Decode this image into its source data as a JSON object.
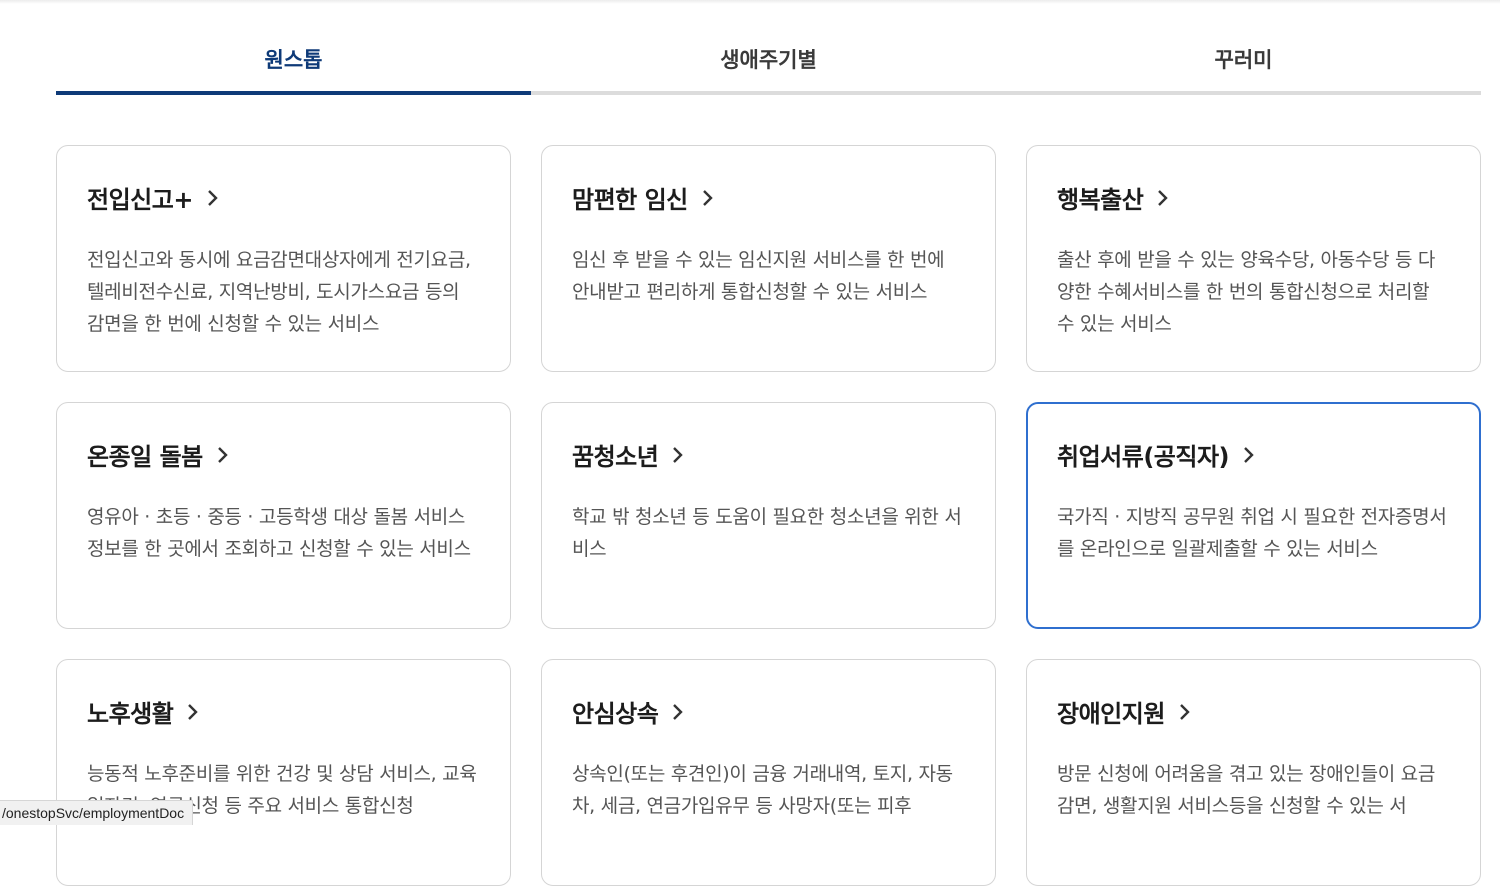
{
  "tabs": [
    {
      "label": "원스톱",
      "active": true
    },
    {
      "label": "생애주기별",
      "active": false
    },
    {
      "label": "꾸러미",
      "active": false
    }
  ],
  "cards": [
    {
      "title": "전입신고+",
      "desc": "전입신고와 동시에 요금감면대상자에게 전기요금, 텔레비전수신료, 지역난방비, 도시가스요금 등의 감면을 한 번에 신청할 수 있는 서비스"
    },
    {
      "title": "맘편한 임신",
      "desc": "임신 후 받을 수 있는 임신지원 서비스를 한 번에 안내받고 편리하게 통합신청할 수 있는 서비스"
    },
    {
      "title": "행복출산",
      "desc": "출산 후에 받을 수 있는 양육수당, 아동수당 등 다양한 수혜서비스를 한 번의 통합신청으로 처리할 수 있는 서비스"
    },
    {
      "title": "온종일 돌봄",
      "desc": "영유아 · 초등 · 중등 · 고등학생 대상 돌봄 서비스 정보를 한 곳에서 조회하고 신청할 수 있는 서비스"
    },
    {
      "title": "꿈청소년",
      "desc": "학교 밖 청소년 등 도움이 필요한 청소년을 위한 서비스"
    },
    {
      "title": "취업서류(공직자)",
      "desc": "국가직 · 지방직 공무원 취업 시 필요한 전자증명서를 온라인으로 일괄제출할 수 있는 서비스",
      "selected": true
    },
    {
      "title": "노후생활",
      "desc": "능동적 노후준비를 위한 건강 및 상담 서비스, 교육 일자리, 연금신청 등 주요 서비스 통합신청"
    },
    {
      "title": "안심상속",
      "desc": "상속인(또는 후견인)이 금융 거래내역, 토지, 자동차, 세금, 연금가입유무 등 사망자(또는 피후"
    },
    {
      "title": "장애인지원",
      "desc": "방문 신청에 어려움을 겪고 있는 장애인들이 요금감면, 생활지원 서비스등을 신청할 수 있는 서"
    }
  ],
  "status_url": "/onestopSvc/employmentDoc"
}
